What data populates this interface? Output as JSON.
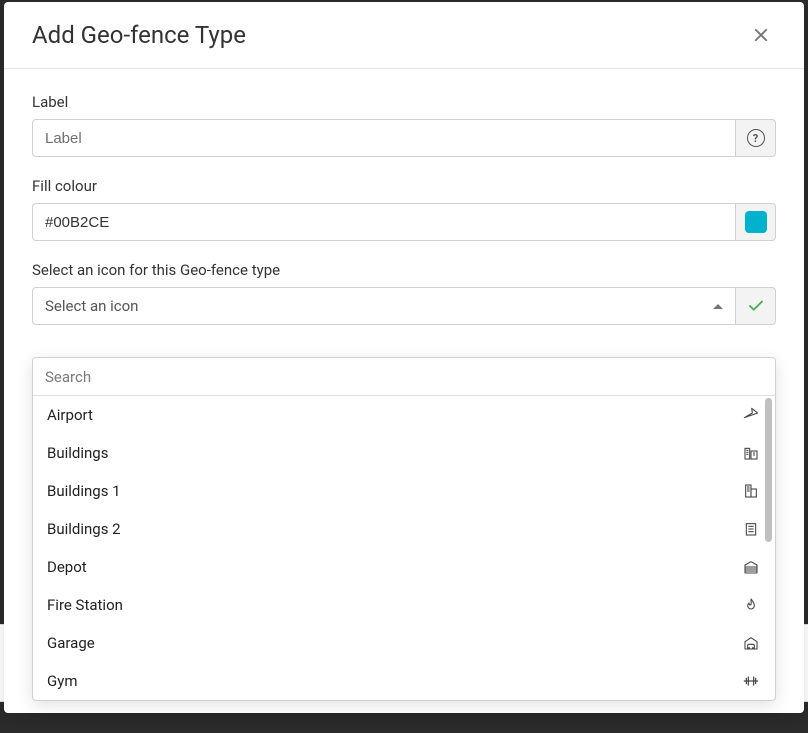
{
  "background_link": "nabl",
  "modal": {
    "title": "Add Geo-fence Type"
  },
  "fields": {
    "label": {
      "label": "Label",
      "placeholder": "Label",
      "value": ""
    },
    "fill_colour": {
      "label": "Fill colour",
      "value": "#00B2CE",
      "swatch_color": "#00B2CE"
    },
    "icon_select": {
      "label": "Select an icon for this Geo-fence type",
      "selected": "Select an icon",
      "search_placeholder": "Search"
    }
  },
  "icon_options": [
    {
      "label": "Airport",
      "icon": "airport"
    },
    {
      "label": "Buildings",
      "icon": "buildings"
    },
    {
      "label": "Buildings 1",
      "icon": "buildings1"
    },
    {
      "label": "Buildings 2",
      "icon": "buildings2"
    },
    {
      "label": "Depot",
      "icon": "depot"
    },
    {
      "label": "Fire Station",
      "icon": "firestation"
    },
    {
      "label": "Garage",
      "icon": "garage"
    },
    {
      "label": "Gym",
      "icon": "gym"
    }
  ]
}
